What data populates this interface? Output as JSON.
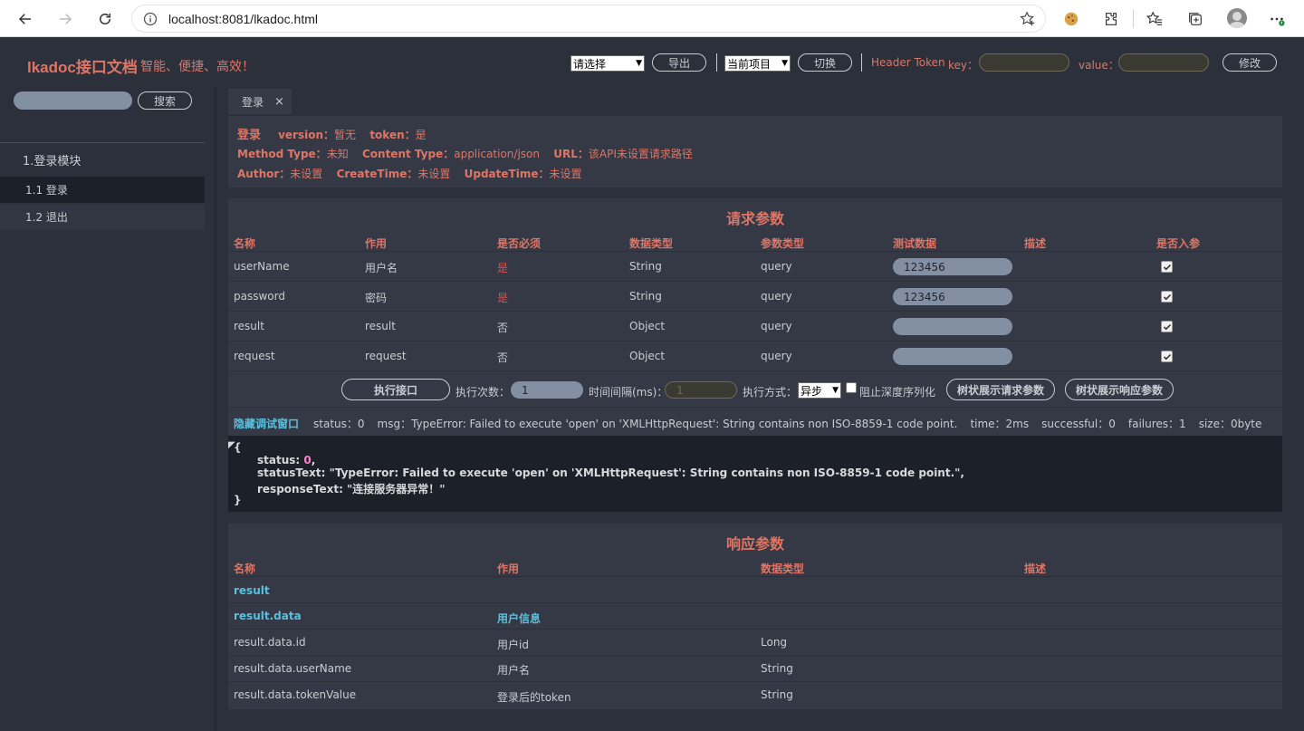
{
  "browser": {
    "url_host": "localhost",
    "url_port_path": ":8081/lkadoc.html"
  },
  "header": {
    "brand": "lkadoc接口文档",
    "slogan": "智能、便捷、高效！",
    "select_default": "请选择",
    "export_label": "导出",
    "project_select": "当前项目",
    "switch_label": "切换",
    "token_label": "Header Token",
    "key_label": "key：",
    "value_label": "value：",
    "modify_label": "修改"
  },
  "sidebar": {
    "search_label": "搜索",
    "module": "1.登录模块",
    "items": [
      {
        "label": "1.1 登录"
      },
      {
        "label": "1.2 退出"
      }
    ]
  },
  "tab": {
    "label": "登录",
    "close": "×"
  },
  "api_info": {
    "name": "登录",
    "version_label": "version：",
    "version": "暂无",
    "token_label": "token：",
    "token": "是",
    "method_label": "Method Type：",
    "method": "未知",
    "content_label": "Content Type：",
    "content": "application/json",
    "url_label": "URL：",
    "url": "该API未设置请求路径",
    "author_label": "Author：",
    "author": "未设置",
    "create_label": "CreateTime：",
    "create": "未设置",
    "update_label": "UpdateTime：",
    "update": "未设置"
  },
  "request": {
    "title": "请求参数",
    "headers": [
      "名称",
      "作用",
      "是否必须",
      "数据类型",
      "参数类型",
      "测试数据",
      "描述",
      "是否入参"
    ],
    "rows": [
      {
        "name": "userName",
        "desc": "用户名",
        "required": "是",
        "type": "String",
        "ptype": "query",
        "test": "123456"
      },
      {
        "name": "password",
        "desc": "密码",
        "required": "是",
        "type": "String",
        "ptype": "query",
        "test": "123456"
      },
      {
        "name": "result",
        "desc": "result",
        "required": "否",
        "type": "Object",
        "ptype": "query",
        "test": ""
      },
      {
        "name": "request",
        "desc": "request",
        "required": "否",
        "type": "Object",
        "ptype": "query",
        "test": ""
      }
    ],
    "execute_label": "执行接口",
    "count_label": "执行次数：",
    "count_value": "1",
    "interval_label": "时间间隔(ms)：",
    "interval_value": "1",
    "mode_label": "执行方式：",
    "mode_value": "异步",
    "deep_label": "阻止深度序列化",
    "tree_req_label": "树状展示请求参数",
    "tree_resp_label": "树状展示响应参数"
  },
  "status": {
    "hide_label": "隐藏调试窗口",
    "status": "status：0",
    "msg": "msg：TypeError: Failed to execute 'open' on 'XMLHttpRequest': String contains non ISO-8859-1 code point.",
    "time": "time：2ms",
    "successful": "successful：0",
    "failures": "failures：1",
    "size": "size：0byte"
  },
  "debug": {
    "open": "{",
    "status_key": "status: ",
    "status_val": "0",
    "status_tail": ",",
    "statusText": "statusText: \"TypeError: Failed to execute 'open' on 'XMLHttpRequest': String contains non ISO-8859-1 code point.\",",
    "responseText": "responseText: \"连接服务器异常！\"",
    "close": "}"
  },
  "response": {
    "title": "响应参数",
    "headers": [
      "名称",
      "作用",
      "数据类型",
      "描述"
    ],
    "rows": [
      {
        "name": "result",
        "desc": "",
        "type": "",
        "bold": true
      },
      {
        "name": "result.data",
        "desc": "用户信息",
        "type": "",
        "bold": true
      },
      {
        "name": "result.data.id",
        "desc": "用户id",
        "type": "Long",
        "bold": false
      },
      {
        "name": "result.data.userName",
        "desc": "用户名",
        "type": "String",
        "bold": false
      },
      {
        "name": "result.data.tokenValue",
        "desc": "登录后的token",
        "type": "String",
        "bold": false
      }
    ]
  }
}
